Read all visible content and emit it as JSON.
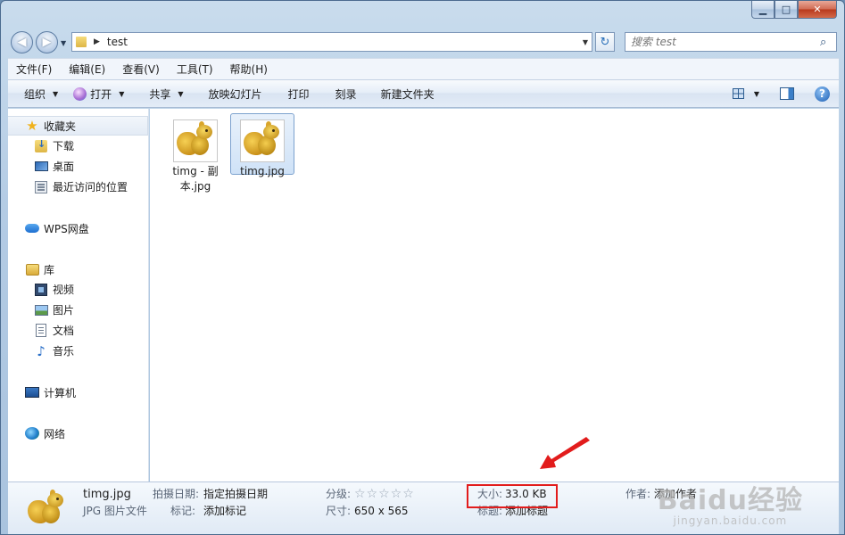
{
  "window": {
    "minimize": "▁",
    "maximize": "□",
    "close": "✕"
  },
  "address": {
    "back": "◀",
    "forward": "▶",
    "path": [
      "test"
    ],
    "refresh": "↻"
  },
  "search": {
    "placeholder": "搜索 test",
    "icon": "search-icon"
  },
  "menu": [
    "文件(F)",
    "编辑(E)",
    "查看(V)",
    "工具(T)",
    "帮助(H)"
  ],
  "toolbar": {
    "organize": "组织",
    "open": "打开",
    "share": "共享",
    "slideshow": "放映幻灯片",
    "print": "打印",
    "burn": "刻录",
    "new_folder": "新建文件夹",
    "help": "?"
  },
  "nav": {
    "favorites": {
      "label": "收藏夹",
      "items": [
        "下载",
        "桌面",
        "最近访问的位置"
      ]
    },
    "wps": {
      "label": "WPS网盘"
    },
    "libraries": {
      "label": "库",
      "items": [
        "视频",
        "图片",
        "文档",
        "音乐"
      ]
    },
    "computer": {
      "label": "计算机"
    },
    "network": {
      "label": "网络"
    }
  },
  "files": [
    {
      "name_line1": "timg - 副",
      "name_line2": "本.jpg",
      "selected": false
    },
    {
      "name": "timg.jpg",
      "selected": true
    }
  ],
  "details": {
    "filename": "timg.jpg",
    "filetype": "JPG 图片文件",
    "taken_label": "拍摄日期:",
    "taken_value": "指定拍摄日期",
    "tags_label": "标记:",
    "tags_value": "添加标记",
    "rating_label": "分级:",
    "rating_stars": "☆☆☆☆☆",
    "rating": 0,
    "dims_label": "尺寸:",
    "dims_value": "650 x 565",
    "size_label": "大小:",
    "size_value": "33.0 KB",
    "title_label": "标题:",
    "title_value": "添加标题",
    "author_label": "作者:",
    "author_value": "添加作者"
  },
  "annotation": {
    "color": "#e21c1c"
  },
  "watermark": {
    "main": "Baidu经验",
    "sub": "jingyan.baidu.com"
  }
}
